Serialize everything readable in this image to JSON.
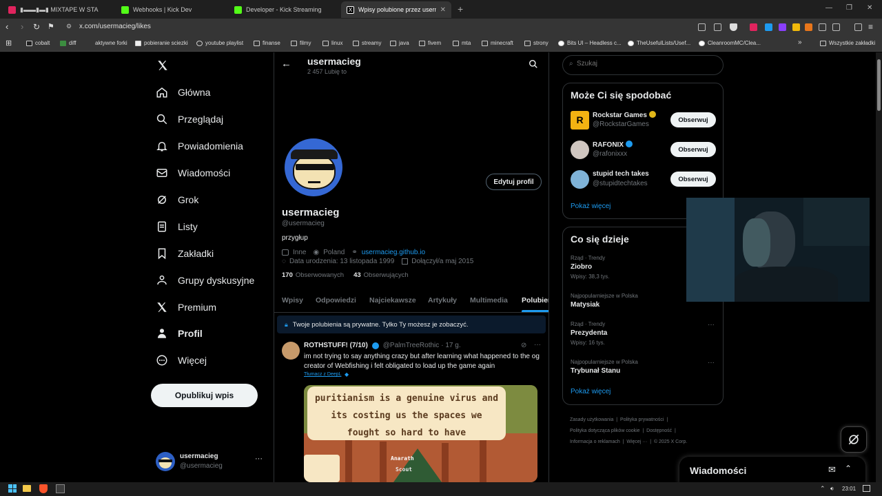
{
  "browser": {
    "tabs": [
      {
        "label": "▮▬▬▮▬▮ MIXTAPE W STA",
        "color": "#e0245e"
      },
      {
        "label": "Webhooks | Kick Dev",
        "color": "#53fc18"
      },
      {
        "label": "Developer - Kick Streaming",
        "color": "#53fc18"
      },
      {
        "label": "Wpisy polubione przez usermac",
        "color": "#ffffff"
      }
    ],
    "url": "x.com/usermacieg/likes",
    "bookmarks": [
      "cobalt",
      "diff",
      "aktywne forki",
      "pobieranie sciezki",
      "youtube playlist",
      "finanse",
      "filmy",
      "linux",
      "streamy",
      "java",
      "fivem",
      "mta",
      "minecraft",
      "strony",
      "Bits UI – Headless c...",
      "TheUsefulLists/Usef...",
      "CleanroomMC/Clea..."
    ],
    "bookmarks_more": "»",
    "all_bookmarks": "Wszystkie zakładki"
  },
  "nav": {
    "items": [
      "Główna",
      "Przeglądaj",
      "Powiadomienia",
      "Wiadomości",
      "Grok",
      "Listy",
      "Zakładki",
      "Grupy dyskusyjne",
      "Premium",
      "Profil",
      "Więcej"
    ],
    "post_button": "Opublikuj wpis",
    "account": {
      "name": "usermacieg",
      "handle": "@usermacieg",
      "more": "···"
    }
  },
  "profile": {
    "header_name": "usermacieg",
    "header_count": "2 457 Lubię to",
    "edit_button": "Edytuj profil",
    "name": "usermacieg",
    "handle": "@usermacieg",
    "bio": "przygłup",
    "category": "Inne",
    "location": "Poland",
    "website": "usermacieg.github.io",
    "birthday": "Data urodzenia: 13 listopada 1999",
    "joined": "Dołączył/a maj 2015",
    "following_count": "170",
    "following_label": "Obserwowanych",
    "followers_count": "43",
    "followers_label": "Obserwujących",
    "tabs": [
      "Wpisy",
      "Odpowiedzi",
      "Najciekawsze",
      "Artykuły",
      "Multimedia",
      "Polubienia"
    ],
    "private_notice": "Twoje polubienia są prywatne. Tylko Ty możesz je zobaczyć."
  },
  "tweet": {
    "author": "ROTHSTUFF! (7/10)",
    "handle": "@PalmTreeRothic",
    "time": "· 17 g.",
    "text": "im not trying to say anything crazy but after learning what happened to the og creator of Webfishing i felt obligated to load up the game again",
    "translate": "Tłumacz z DeepL",
    "image_text": "puritianism is a genuine virus and its costing us the spaces we fought so hard to have",
    "image_caption1": "Anarath",
    "image_caption2": "Scout"
  },
  "search": {
    "placeholder": "Szukaj"
  },
  "suggestions": {
    "title": "Może Ci się spodobać",
    "users": [
      {
        "name": "Rockstar Games",
        "handle": "@RockstarGames",
        "badge": "gold"
      },
      {
        "name": "RAFONIX",
        "handle": "@rafonixxx",
        "badge": "blue"
      },
      {
        "name": "stupid tech takes",
        "handle": "@stupidtechtakes",
        "badge": ""
      }
    ],
    "follow_label": "Obserwuj",
    "show_more": "Pokaż więcej"
  },
  "trends": {
    "title": "Co się dzieje",
    "items": [
      {
        "context": "Rząd · Trendy",
        "name": "Ziobro",
        "count": "Wpisy: 38,3 tys."
      },
      {
        "context": "Najpopularniejsze w Polska",
        "name": "Matysiak",
        "count": ""
      },
      {
        "context": "Rząd · Trendy",
        "name": "Prezydenta",
        "count": "Wpisy: 16 tys."
      },
      {
        "context": "Najpopularniejsze w Polska",
        "name": "Trybunał Stanu",
        "count": ""
      }
    ],
    "show_more": "Pokaż więcej"
  },
  "footer": {
    "links": [
      "Zasady użytkowania",
      "Polityka prywatności",
      "Polityka dotycząca plików cookie",
      "Dostępność",
      "Informacja o reklamach",
      "Więcej ···"
    ],
    "copyright": "© 2025 X Corp."
  },
  "messages_drawer": {
    "label": "Wiadomości"
  },
  "taskbar": {
    "time": "23:01"
  },
  "colors": {
    "accent": "#1d9bf0",
    "background": "#000000",
    "border": "#2f3336"
  }
}
